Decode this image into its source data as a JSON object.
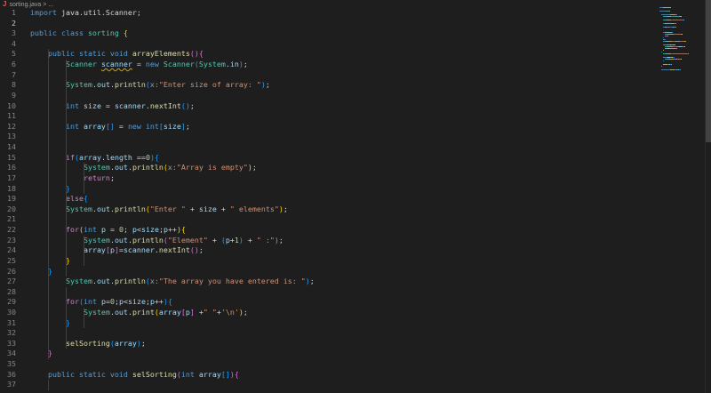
{
  "breadcrumb": {
    "file": "sorting.java",
    "separator": ">",
    "rest": "..."
  },
  "lines": [
    {
      "n": "1",
      "tokens": [
        [
          "k",
          "import "
        ],
        [
          "d",
          "java.util.Scanner;"
        ]
      ]
    },
    {
      "n": "2",
      "tokens": []
    },
    {
      "n": "3",
      "tokens": [
        [
          "k",
          "public class "
        ],
        [
          "t",
          "sorting "
        ],
        [
          "p1",
          "{"
        ]
      ]
    },
    {
      "n": "4",
      "tokens": []
    },
    {
      "n": "5",
      "tokens": [
        [
          "d",
          "    "
        ],
        [
          "k",
          "public static void "
        ],
        [
          "f",
          "arrayElements"
        ],
        [
          "p2",
          "()"
        ],
        [
          "p2",
          "{"
        ]
      ]
    },
    {
      "n": "6",
      "tokens": [
        [
          "d",
          "        "
        ],
        [
          "t",
          "Scanner "
        ],
        [
          "sq",
          "scanner"
        ],
        [
          "d",
          " = "
        ],
        [
          "k",
          "new "
        ],
        [
          "t",
          "Scanner"
        ],
        [
          "p3",
          "("
        ],
        [
          "t",
          "System"
        ],
        [
          "d",
          "."
        ],
        [
          "v",
          "in"
        ],
        [
          "p3",
          ")"
        ],
        [
          "d",
          ";"
        ]
      ]
    },
    {
      "n": "7",
      "tokens": []
    },
    {
      "n": "8",
      "tokens": [
        [
          "d",
          "        "
        ],
        [
          "t",
          "System"
        ],
        [
          "d",
          "."
        ],
        [
          "v",
          "out"
        ],
        [
          "d",
          "."
        ],
        [
          "f",
          "println"
        ],
        [
          "p3",
          "("
        ],
        [
          "h",
          "x:"
        ],
        [
          "s",
          "\"Enter size of array: \""
        ],
        [
          "p3",
          ")"
        ],
        [
          "d",
          ";"
        ]
      ]
    },
    {
      "n": "9",
      "tokens": []
    },
    {
      "n": "10",
      "tokens": [
        [
          "d",
          "        "
        ],
        [
          "k",
          "int "
        ],
        [
          "v",
          "size"
        ],
        [
          "d",
          " = "
        ],
        [
          "v",
          "scanner"
        ],
        [
          "d",
          "."
        ],
        [
          "f",
          "nextInt"
        ],
        [
          "p3",
          "()"
        ],
        [
          "d",
          ";"
        ]
      ]
    },
    {
      "n": "11",
      "tokens": []
    },
    {
      "n": "12",
      "tokens": [
        [
          "d",
          "        "
        ],
        [
          "k",
          "int "
        ],
        [
          "v",
          "array"
        ],
        [
          "p3",
          "[]"
        ],
        [
          "d",
          " = "
        ],
        [
          "k",
          "new "
        ],
        [
          "k",
          "int"
        ],
        [
          "p3",
          "["
        ],
        [
          "v",
          "size"
        ],
        [
          "p3",
          "]"
        ],
        [
          "d",
          ";"
        ]
      ]
    },
    {
      "n": "13",
      "tokens": []
    },
    {
      "n": "14",
      "tokens": []
    },
    {
      "n": "15",
      "tokens": [
        [
          "d",
          "        "
        ],
        [
          "c",
          "if"
        ],
        [
          "p3",
          "("
        ],
        [
          "v",
          "array"
        ],
        [
          "d",
          "."
        ],
        [
          "v",
          "length"
        ],
        [
          "d",
          " =="
        ],
        [
          "n",
          "0"
        ],
        [
          "p3",
          ")"
        ],
        [
          "p3",
          "{"
        ]
      ]
    },
    {
      "n": "16",
      "tokens": [
        [
          "d",
          "            "
        ],
        [
          "t",
          "System"
        ],
        [
          "d",
          "."
        ],
        [
          "v",
          "out"
        ],
        [
          "d",
          "."
        ],
        [
          "f",
          "println"
        ],
        [
          "p1",
          "("
        ],
        [
          "h",
          "x:"
        ],
        [
          "s",
          "\"Array is empty\""
        ],
        [
          "p1",
          ")"
        ],
        [
          "d",
          ";"
        ]
      ]
    },
    {
      "n": "17",
      "tokens": [
        [
          "d",
          "            "
        ],
        [
          "c",
          "return"
        ],
        [
          "d",
          ";"
        ]
      ]
    },
    {
      "n": "18",
      "tokens": [
        [
          "d",
          "        "
        ],
        [
          "p3",
          "}"
        ]
      ]
    },
    {
      "n": "19",
      "tokens": [
        [
          "d",
          "        "
        ],
        [
          "c",
          "else"
        ],
        [
          "p3",
          "{"
        ]
      ]
    },
    {
      "n": "20",
      "tokens": [
        [
          "d",
          "        "
        ],
        [
          "t",
          "System"
        ],
        [
          "d",
          "."
        ],
        [
          "v",
          "out"
        ],
        [
          "d",
          "."
        ],
        [
          "f",
          "println"
        ],
        [
          "p1",
          "("
        ],
        [
          "s",
          "\"Enter \""
        ],
        [
          "d",
          " + "
        ],
        [
          "v",
          "size"
        ],
        [
          "d",
          " + "
        ],
        [
          "s",
          "\" elements\""
        ],
        [
          "p1",
          ")"
        ],
        [
          "d",
          ";"
        ]
      ]
    },
    {
      "n": "21",
      "tokens": []
    },
    {
      "n": "22",
      "tokens": [
        [
          "d",
          "        "
        ],
        [
          "c",
          "for"
        ],
        [
          "p1",
          "("
        ],
        [
          "k",
          "int "
        ],
        [
          "v",
          "p"
        ],
        [
          "d",
          " = "
        ],
        [
          "n",
          "0"
        ],
        [
          "d",
          "; "
        ],
        [
          "v",
          "p"
        ],
        [
          "d",
          "<"
        ],
        [
          "v",
          "size"
        ],
        [
          "d",
          ";"
        ],
        [
          "v",
          "p"
        ],
        [
          "d",
          "++"
        ],
        [
          "p1",
          ")"
        ],
        [
          "p1",
          "{"
        ]
      ]
    },
    {
      "n": "23",
      "tokens": [
        [
          "d",
          "            "
        ],
        [
          "t",
          "System"
        ],
        [
          "d",
          "."
        ],
        [
          "v",
          "out"
        ],
        [
          "d",
          "."
        ],
        [
          "f",
          "println"
        ],
        [
          "p2",
          "("
        ],
        [
          "s",
          "\"Element\""
        ],
        [
          "d",
          " + "
        ],
        [
          "p3",
          "("
        ],
        [
          "v",
          "p"
        ],
        [
          "d",
          "+"
        ],
        [
          "n",
          "1"
        ],
        [
          "p3",
          ")"
        ],
        [
          "d",
          " + "
        ],
        [
          "s",
          "\" :\""
        ],
        [
          "p2",
          ")"
        ],
        [
          "d",
          ";"
        ]
      ]
    },
    {
      "n": "24",
      "tokens": [
        [
          "d",
          "            "
        ],
        [
          "v",
          "array"
        ],
        [
          "p2",
          "["
        ],
        [
          "v",
          "p"
        ],
        [
          "p2",
          "]"
        ],
        [
          "d",
          "="
        ],
        [
          "v",
          "scanner"
        ],
        [
          "d",
          "."
        ],
        [
          "f",
          "nextInt"
        ],
        [
          "p2",
          "()"
        ],
        [
          "d",
          ";"
        ]
      ]
    },
    {
      "n": "25",
      "tokens": [
        [
          "d",
          "        "
        ],
        [
          "p1",
          "}"
        ]
      ]
    },
    {
      "n": "26",
      "tokens": [
        [
          "d",
          "    "
        ],
        [
          "p3",
          "}"
        ]
      ]
    },
    {
      "n": "27",
      "tokens": [
        [
          "d",
          "        "
        ],
        [
          "t",
          "System"
        ],
        [
          "d",
          "."
        ],
        [
          "v",
          "out"
        ],
        [
          "d",
          "."
        ],
        [
          "f",
          "println"
        ],
        [
          "p3",
          "("
        ],
        [
          "h",
          "x:"
        ],
        [
          "s",
          "\"The array you have entered is: \""
        ],
        [
          "p3",
          ")"
        ],
        [
          "d",
          ";"
        ]
      ]
    },
    {
      "n": "28",
      "tokens": []
    },
    {
      "n": "29",
      "tokens": [
        [
          "d",
          "        "
        ],
        [
          "c",
          "for"
        ],
        [
          "p3",
          "("
        ],
        [
          "k",
          "int "
        ],
        [
          "v",
          "p"
        ],
        [
          "d",
          "="
        ],
        [
          "n",
          "0"
        ],
        [
          "d",
          ";"
        ],
        [
          "v",
          "p"
        ],
        [
          "d",
          "<"
        ],
        [
          "v",
          "size"
        ],
        [
          "d",
          ";"
        ],
        [
          "v",
          "p"
        ],
        [
          "d",
          "++"
        ],
        [
          "p3",
          ")"
        ],
        [
          "p3",
          "{"
        ]
      ]
    },
    {
      "n": "30",
      "tokens": [
        [
          "d",
          "            "
        ],
        [
          "t",
          "System"
        ],
        [
          "d",
          "."
        ],
        [
          "v",
          "out"
        ],
        [
          "d",
          "."
        ],
        [
          "f",
          "print"
        ],
        [
          "p1",
          "("
        ],
        [
          "v",
          "array"
        ],
        [
          "p2",
          "["
        ],
        [
          "v",
          "p"
        ],
        [
          "p2",
          "]"
        ],
        [
          "d",
          " +"
        ],
        [
          "s",
          "\" \""
        ],
        [
          "d",
          "+"
        ],
        [
          "s",
          "'\\n'"
        ],
        [
          "p1",
          ")"
        ],
        [
          "d",
          ";"
        ]
      ]
    },
    {
      "n": "31",
      "tokens": [
        [
          "d",
          "        "
        ],
        [
          "p3",
          "}"
        ]
      ]
    },
    {
      "n": "32",
      "tokens": []
    },
    {
      "n": "33",
      "tokens": [
        [
          "d",
          "        "
        ],
        [
          "f",
          "selSorting"
        ],
        [
          "p3",
          "("
        ],
        [
          "v",
          "array"
        ],
        [
          "p3",
          ")"
        ],
        [
          "d",
          ";"
        ]
      ]
    },
    {
      "n": "34",
      "tokens": [
        [
          "d",
          "    "
        ],
        [
          "p2",
          "}"
        ]
      ]
    },
    {
      "n": "35",
      "tokens": []
    },
    {
      "n": "36",
      "tokens": [
        [
          "d",
          "    "
        ],
        [
          "k",
          "public static void "
        ],
        [
          "f",
          "selSorting"
        ],
        [
          "p2",
          "("
        ],
        [
          "k",
          "int "
        ],
        [
          "v",
          "array"
        ],
        [
          "p3",
          "[]"
        ],
        [
          "p2",
          ")"
        ],
        [
          "p2",
          "{"
        ]
      ]
    },
    {
      "n": "37",
      "tokens": []
    }
  ],
  "current_line": "2"
}
